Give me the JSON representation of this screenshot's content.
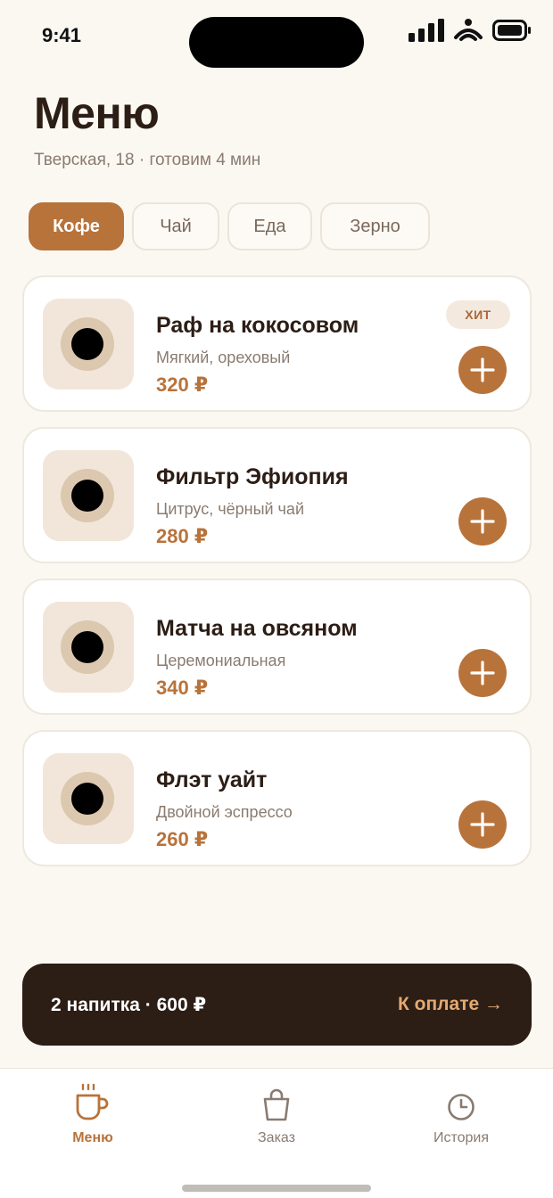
{
  "status_bar": {
    "time": "9:41"
  },
  "header": {
    "title": "Меню",
    "subtitle": "Тверская, 18 · готовим 4 мин"
  },
  "tabs": [
    {
      "label": "Кофе",
      "active": true
    },
    {
      "label": "Чай",
      "active": false
    },
    {
      "label": "Еда",
      "active": false
    },
    {
      "label": "Зерно",
      "active": false
    }
  ],
  "items": [
    {
      "name": "Раф на кокосовом",
      "description": "Мягкий, ореховый",
      "price": "320 ₽",
      "badge": "ХИТ"
    },
    {
      "name": "Фильтр Эфиопия",
      "description": "Цитрус, чёрный чай",
      "price": "280 ₽"
    },
    {
      "name": "Матча на овсяном",
      "description": "Церемониальная",
      "price": "340 ₽"
    },
    {
      "name": "Флэт уайт",
      "description": "Двойной эспрессо",
      "price": "260 ₽"
    }
  ],
  "cart": {
    "summary": "2 напитка · 600 ₽",
    "checkout_label": "К оплате →"
  },
  "bottom_nav": [
    {
      "label": "Меню",
      "icon": "coffee-cup-icon",
      "active": true
    },
    {
      "label": "Заказ",
      "icon": "shopping-bag-icon",
      "active": false
    },
    {
      "label": "История",
      "icon": "clock-icon",
      "active": false
    }
  ],
  "colors": {
    "background": "#fbf8f2",
    "accent": "#b8733b",
    "dark": "#2c1d15",
    "muted_text": "#8a7b70",
    "checkout_text": "#e4a971"
  }
}
